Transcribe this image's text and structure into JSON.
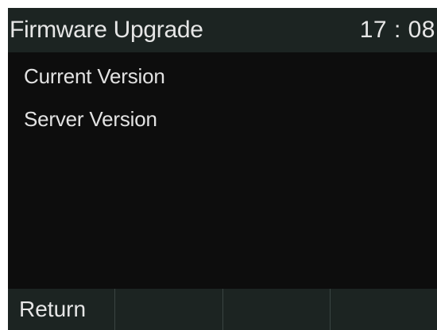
{
  "header": {
    "title": "Firmware Upgrade",
    "time": "17 : 08"
  },
  "info": {
    "current_version_label": "Current Version",
    "server_version_label": "Server Version"
  },
  "softkeys": [
    {
      "label": "Return"
    },
    {
      "label": ""
    },
    {
      "label": ""
    },
    {
      "label": ""
    }
  ],
  "colors": {
    "bar_background": "#1c2422",
    "screen_background": "#0d0d0d",
    "text": "#e6e6e6"
  }
}
